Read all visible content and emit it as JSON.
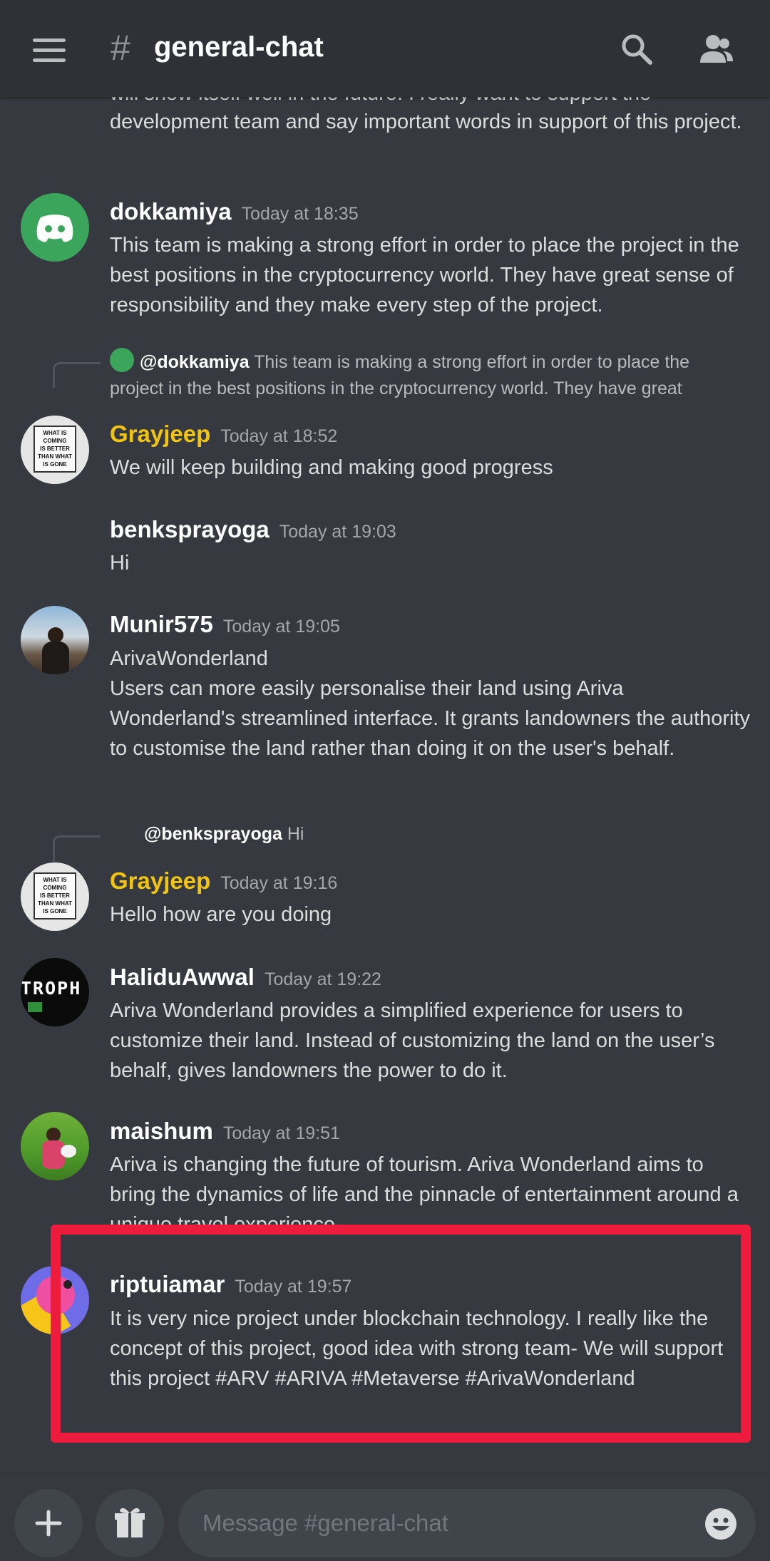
{
  "channel": {
    "hash": "#",
    "title": "general-chat"
  },
  "header_icons": {
    "menu": "hamburger-icon",
    "search": "search-icon",
    "members": "members-icon"
  },
  "messages": [
    {
      "text_partial_top": "will show itself well in the future. I really want to support the",
      "text": "development team and say important words in support of this project."
    },
    {
      "author": "dokkamiya",
      "time": "Today at 18:35",
      "text": "This team is making a strong effort in order to place the project in the best positions in the cryptocurrency world. They have great sense of responsibility and they make every step of the project."
    },
    {
      "reply_to": "@dokkamiya",
      "reply_text": "This team is making a strong effort in order to place the project in the best positions in the cryptocurrency world. They have great",
      "author": "Grayjeep",
      "time": "Today at 18:52",
      "text": "We will keep building and making good progress",
      "avatar_sign": [
        "WHAT IS",
        "COMING",
        "IS BETTER",
        "THAN WHAT",
        "IS GONE"
      ]
    },
    {
      "author": "benksprayoga",
      "time": "Today at 19:03",
      "text": "Hi"
    },
    {
      "author": "Munir575",
      "time": "Today at 19:05",
      "text_line1": "ArivaWonderland",
      "text": "Users can more easily personalise their land using Ariva Wonderland's streamlined interface. It grants landowners the authority to customise the land rather than doing it on the user's behalf."
    },
    {
      "reply_to": "@benksprayoga",
      "reply_text": "Hi",
      "author": "Grayjeep",
      "time": "Today at 19:16",
      "text": "Hello how are you doing"
    },
    {
      "author": "HaliduAwwal",
      "time": "Today at 19:22",
      "avatar_text": "TROPH",
      "text": "Ariva Wonderland provides a simplified experience for users to customize their land. Instead of customizing the land on the user’s behalf, gives landowners the power to do it."
    },
    {
      "author": "maishum",
      "time": "Today at 19:51",
      "text": "Ariva is changing the future of tourism. Ariva Wonderland aims to bring the dynamics of life and the pinnacle of entertainment around a unique travel experience."
    },
    {
      "author": "riptuiamar",
      "time": "Today at 19:57",
      "text": "It is  very nice project under blockchain technology. I really like the concept of this project, good idea with strong team- We will support this project #ARV #ARIVA #Metaverse #ArivaWonderland"
    }
  ],
  "composer": {
    "placeholder": "Message #general-chat"
  },
  "colors": {
    "background": "#36393f",
    "header": "#2f3136",
    "highlight": "#ed1c3c",
    "gold_name": "#f1c40f",
    "discord_green": "#3ba55c"
  }
}
